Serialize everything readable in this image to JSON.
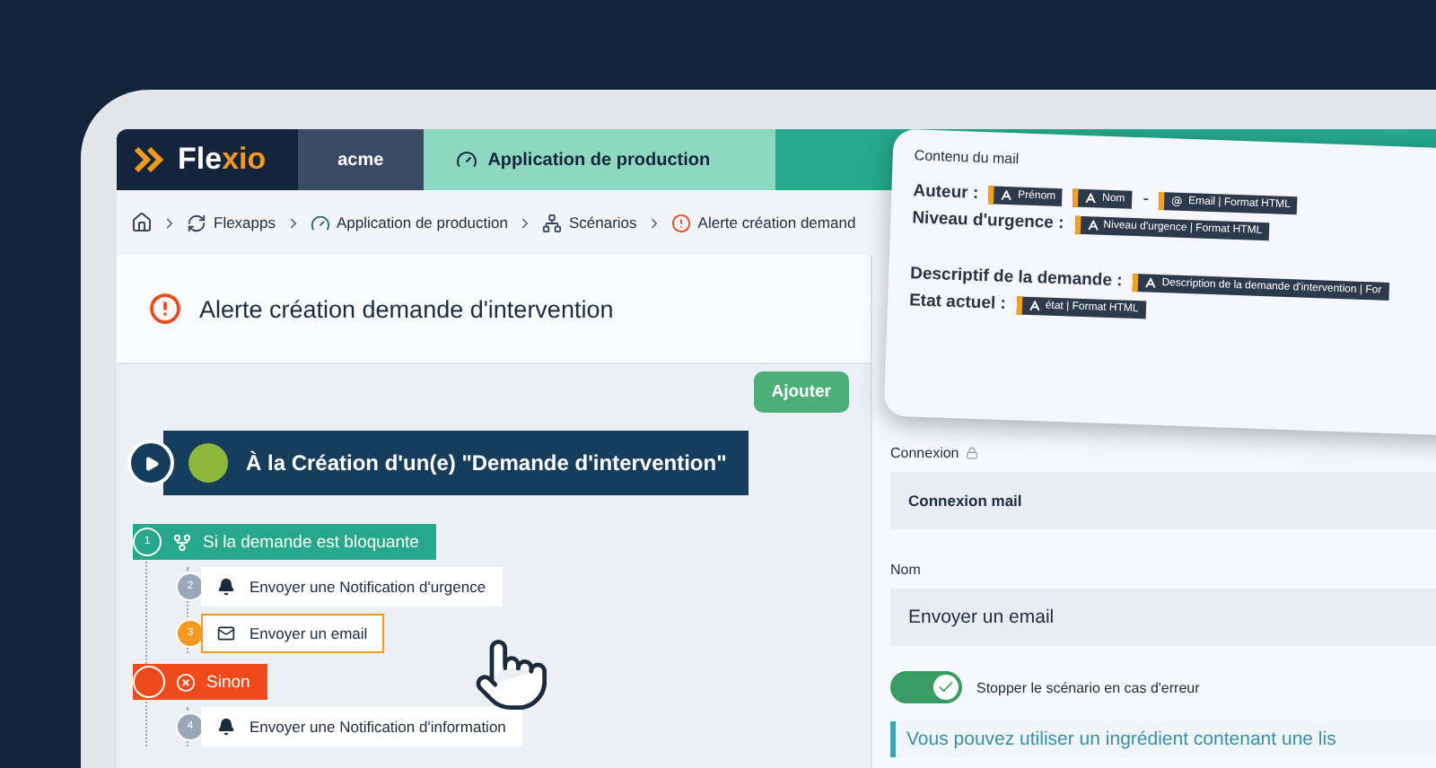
{
  "topbar": {
    "logo": "Fle",
    "logo_accent": "xio",
    "org": "acme",
    "app": "Application de production"
  },
  "breadcrumb": [
    {
      "kind": "flexapps",
      "label": "Flexapps"
    },
    {
      "kind": "app",
      "label": "Application de production"
    },
    {
      "kind": "scenarios",
      "label": "Scénarios"
    },
    {
      "kind": "alert",
      "label": "Alerte création demand"
    }
  ],
  "title": "Alerte création demande d'intervention",
  "add_button": "Ajouter",
  "trigger": "À la Création d'un(e) \"Demande d'intervention\"",
  "steps": [
    {
      "kind": "condition",
      "number": "1",
      "label": "Si la demande est bloquante",
      "children": [
        {
          "kind": "notification",
          "number": "2",
          "label": "Envoyer une Notification d'urgence",
          "selected": false
        },
        {
          "kind": "email",
          "number": "3",
          "label": "Envoyer un email",
          "selected": true
        }
      ]
    },
    {
      "kind": "else",
      "label": "Sinon",
      "children": [
        {
          "kind": "notification",
          "number": "4",
          "label": "Envoyer une Notification d'information",
          "selected": false
        }
      ]
    }
  ],
  "mail_card": {
    "title": "Contenu du mail",
    "lines": [
      {
        "label": "Auteur :",
        "gap_before": false,
        "parts": [
          {
            "kind": "text",
            "label": "Prénom"
          },
          {
            "kind": "text",
            "label": "Nom"
          },
          {
            "kind": "plain",
            "label": "-"
          },
          {
            "kind": "email",
            "label": "Email | Format HTML"
          }
        ]
      },
      {
        "label": "Niveau d'urgence :",
        "gap_before": false,
        "parts": [
          {
            "kind": "text",
            "label": "Niveau d'urgence | Format HTML"
          }
        ]
      },
      {
        "label": "Descriptif de la demande :",
        "gap_before": true,
        "parts": [
          {
            "kind": "text",
            "label": "Description de la demande d'intervention | For"
          }
        ]
      },
      {
        "label": "Etat actuel :",
        "gap_before": false,
        "parts": [
          {
            "kind": "text",
            "label": "état | Format HTML"
          }
        ]
      }
    ]
  },
  "connexion": {
    "label": "Connexion",
    "locked": true,
    "value": "Connexion mail"
  },
  "name_field": {
    "label": "Nom",
    "value": "Envoyer un email"
  },
  "stop_toggle": {
    "label": "Stopper le scénario en cas d'erreur",
    "on": true
  },
  "info": "Vous pouvez utiliser un ingrédient contenant une lis"
}
